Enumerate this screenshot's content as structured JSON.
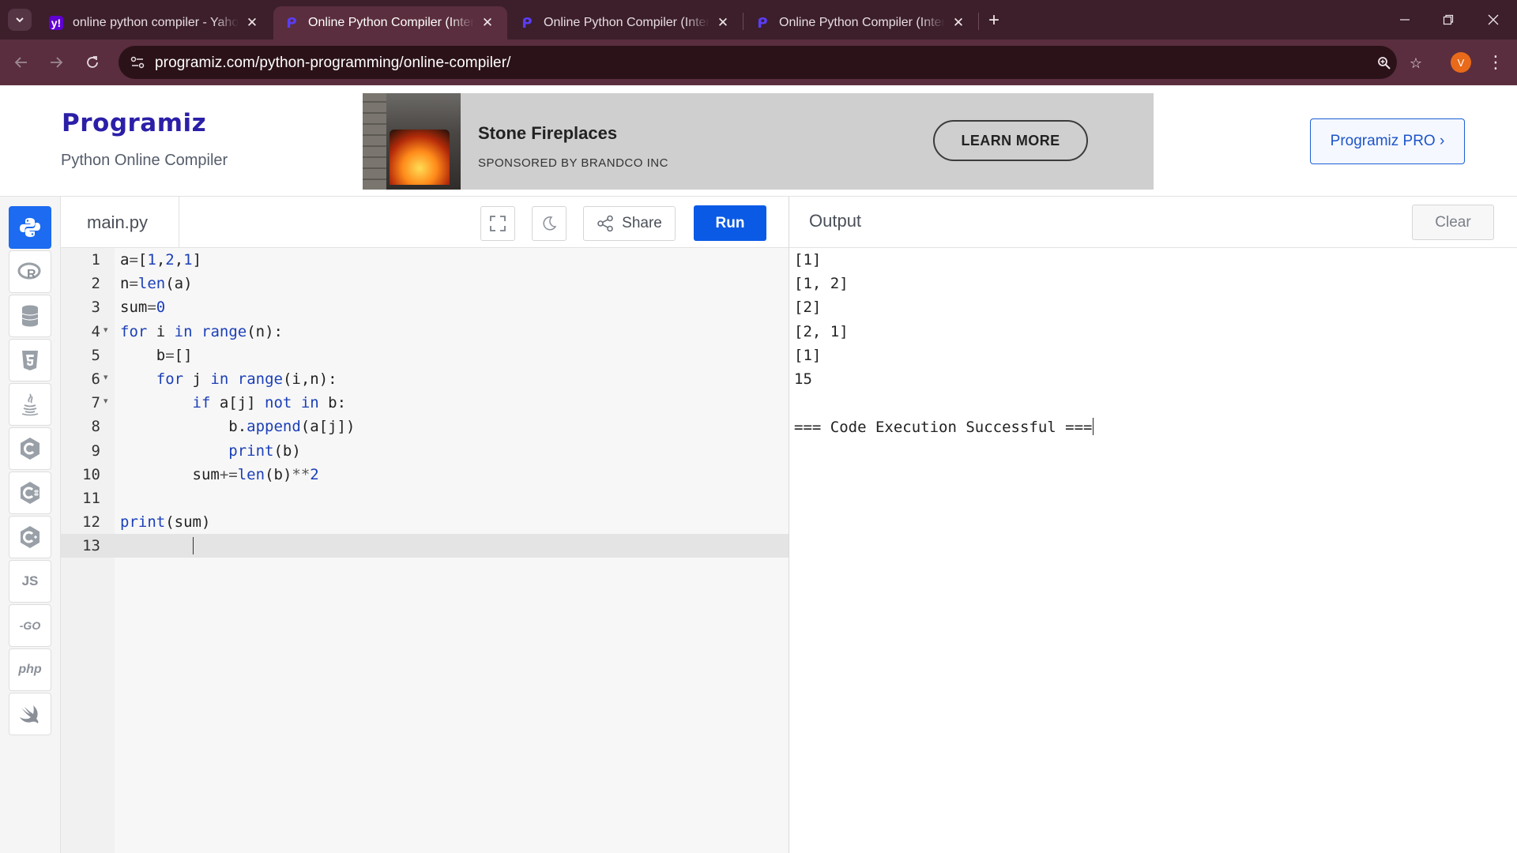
{
  "browser": {
    "tabs": [
      {
        "title": "online python compiler - Yahoo",
        "favicon": "yahoo-icon",
        "active": false
      },
      {
        "title": "Online Python Compiler (Interpreter)",
        "favicon": "programiz-icon",
        "active": true
      },
      {
        "title": "Online Python Compiler (Interpreter)",
        "favicon": "programiz-icon",
        "active": false
      },
      {
        "title": "Online Python Compiler (Interpreter)",
        "favicon": "programiz-icon",
        "active": false
      }
    ],
    "url": "programiz.com/python-programming/online-compiler/",
    "profile_initial": "V",
    "colors": {
      "titlebar": "#3c1f2a",
      "toolbar": "#5a2e3e",
      "omnibox": "#2b1219",
      "profile": "#e86a1a"
    }
  },
  "site": {
    "logo_text": "rogramiz",
    "logo_mark": "P",
    "subtitle": "Python Online Compiler",
    "pro_button": "Programiz PRO ›"
  },
  "ad": {
    "title": "Stone Fireplaces",
    "sponsor": "SPONSORED BY BRANDCO INC",
    "cta": "LEARN MORE"
  },
  "languages": [
    "python",
    "r",
    "sql",
    "html",
    "java",
    "c",
    "csharp",
    "cpp",
    "js",
    "go",
    "php",
    "swift"
  ],
  "language_labels": {
    "js": "JS",
    "go": "-GO",
    "php": "php"
  },
  "editor": {
    "filename": "main.py",
    "share_label": "Share",
    "run_label": "Run",
    "lines": [
      "a=[1,2,1]",
      "n=len(a)",
      "sum=0",
      "for i in range(n):",
      "    b=[]",
      "    for j in range(i,n):",
      "        if a[j] not in b:",
      "            b.append(a[j])",
      "            print(b)",
      "        sum+=len(b)**2",
      "",
      "print(sum)",
      ""
    ],
    "line_numbers": [
      "1",
      "2",
      "3",
      "4",
      "5",
      "6",
      "7",
      "8",
      "9",
      "10",
      "11",
      "12",
      "13"
    ],
    "current_line": 13,
    "foldable_lines": [
      4,
      6,
      7
    ]
  },
  "output": {
    "title": "Output",
    "clear_label": "Clear",
    "lines": [
      "[1]",
      "[1, 2]",
      "[2]",
      "[2, 1]",
      "[1]",
      "15",
      "",
      "=== Code Execution Successful ==="
    ]
  },
  "accent": {
    "run": "#0a5ae6",
    "active_lang": "#1c6bf0"
  }
}
